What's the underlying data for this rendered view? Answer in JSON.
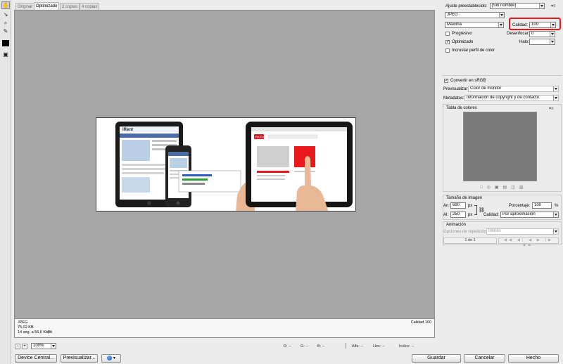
{
  "tabs": [
    "Original",
    "Optimizado",
    "2 copias",
    "4 copias"
  ],
  "info": {
    "format": "JPEG",
    "size": "75,02 KB",
    "time": "14 seg. a 56,6 Kbps",
    "quality": "Calidad 100"
  },
  "status": {
    "zoom": "100%",
    "r": "R: --",
    "g": "G: --",
    "b": "B: --",
    "alpha": "Alfa: --",
    "hex": "Hex: --",
    "index": "Índice: --"
  },
  "buttons": {
    "device_central": "Device Central...",
    "preview": "Previsualizar...",
    "save": "Guardar",
    "cancel": "Cancelar",
    "done": "Hecho"
  },
  "panel": {
    "preset_label": "Ajuste preestablecido:",
    "preset_value": "[Sin nombre]",
    "format_value": "JPEG",
    "compression_value": "Máxima",
    "quality_label": "Calidad:",
    "quality_value": "100",
    "progressive_label": "Progresivo",
    "blur_label": "Desenfocar:",
    "blur_value": "0",
    "optimized_label": "Optimizado",
    "halo_label": "Halo:",
    "halo_value": "",
    "embed_profile_label": "Incrustar perfil de color",
    "srgb_label": "Convertir en sRGB",
    "preview_label": "Previsualizar:",
    "preview_value": "Color de monitor",
    "metadata_label": "Metadatos:",
    "metadata_value": "Información de copyright y de contacto",
    "color_table_label": "Tabla de colores",
    "image_size_label": "Tamaño de imagen",
    "width_label": "An:",
    "width_value": "690",
    "height_label": "Al:",
    "height_value": "250",
    "px_unit": "px",
    "percent_label": "Porcentaje:",
    "percent_value": "100",
    "percent_unit": "%",
    "size_quality_label": "Calidad:",
    "size_quality_value": "Por aproximación",
    "animation_label": "Animación",
    "loop_label": "Opciones de repetición:",
    "loop_value": "Infinito",
    "frame_counter": "1 de 1"
  },
  "preview_image": {
    "site_name": "iRent",
    "video_brand": "YouTube"
  },
  "colors": {
    "highlight": "#e8191a",
    "canvas": "#a7a7a7",
    "color_table": "#7a7a7a"
  }
}
